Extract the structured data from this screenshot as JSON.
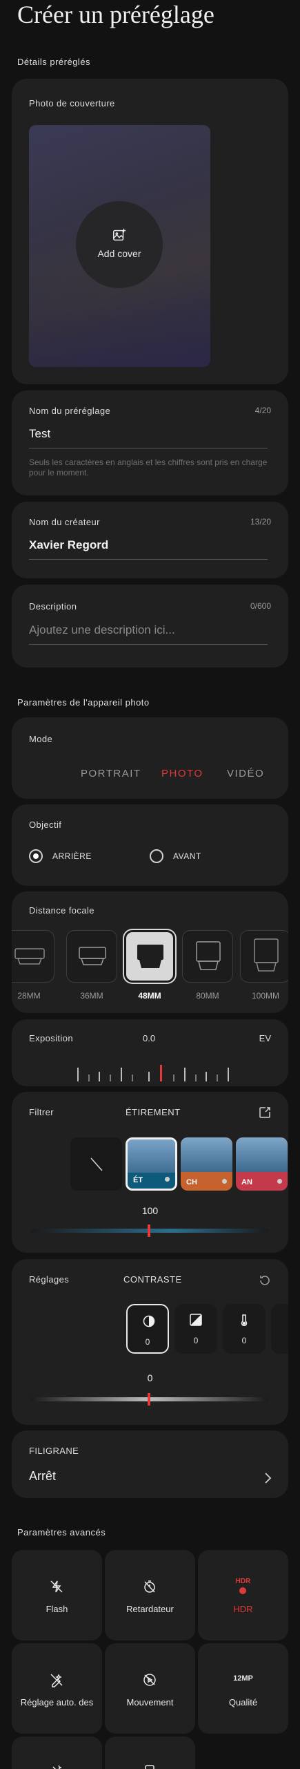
{
  "page": {
    "title": "Créer un préréglage"
  },
  "details": {
    "section_label": "Détails préréglés",
    "cover": {
      "label": "Photo de couverture",
      "button_label": "Add cover"
    },
    "preset_name": {
      "label": "Nom du préréglage",
      "counter": "4/20",
      "value": "Test",
      "hint": "Seuls les caractères en anglais et les chiffres sont pris en charge pour le moment."
    },
    "creator": {
      "label": "Nom du créateur",
      "counter": "13/20",
      "value": "Xavier Regord"
    },
    "description": {
      "label": "Description",
      "counter": "0/600",
      "placeholder": "Ajoutez une description ici..."
    }
  },
  "camera": {
    "section_label": "Paramètres de l'appareil photo",
    "mode": {
      "label": "Mode",
      "options": [
        "PORTRAIT",
        "PHOTO",
        "VIDÉO"
      ],
      "selected": "PHOTO"
    },
    "lens": {
      "label": "Objectif",
      "options": [
        "ARRIÈRE",
        "AVANT"
      ],
      "selected": "ARRIÈRE"
    },
    "focal": {
      "label": "Distance focale",
      "options": [
        "28MM",
        "36MM",
        "48MM",
        "80MM",
        "100MM"
      ],
      "selected": "48MM"
    },
    "exposure": {
      "label": "Exposition",
      "value": "0.0",
      "unit": "EV"
    },
    "filter": {
      "label": "Filtrer",
      "name": "ÉTIREMENT",
      "items": [
        "ÉT",
        "CH",
        "AN"
      ],
      "selected": "ÉT",
      "value": "100"
    },
    "adjust": {
      "label": "Réglages",
      "name": "CONTRASTE",
      "values": [
        "0",
        "0",
        "0"
      ],
      "slider_value": "0"
    },
    "watermark": {
      "label": "FILIGRANE",
      "value": "Arrêt"
    }
  },
  "advanced": {
    "section_label": "Paramètres avancés",
    "tiles": [
      {
        "label": "Flash",
        "icon": "flash-off-icon"
      },
      {
        "label": "Retardateur",
        "icon": "timer-off-icon"
      },
      {
        "label": "HDR",
        "icon": "hdr-auto-icon",
        "badge": "HDR"
      },
      {
        "label": "Réglage auto. des",
        "icon": "auto-adjust-off-icon"
      },
      {
        "label": "Mouvement",
        "icon": "motion-off-icon"
      },
      {
        "label": "Qualité",
        "icon": "resolution-icon",
        "badge": "12MP"
      }
    ]
  },
  "colors": {
    "background": "#121212",
    "card": "#202020",
    "accent": "#e03a3a",
    "filter_selected": "#0e5a7a"
  }
}
